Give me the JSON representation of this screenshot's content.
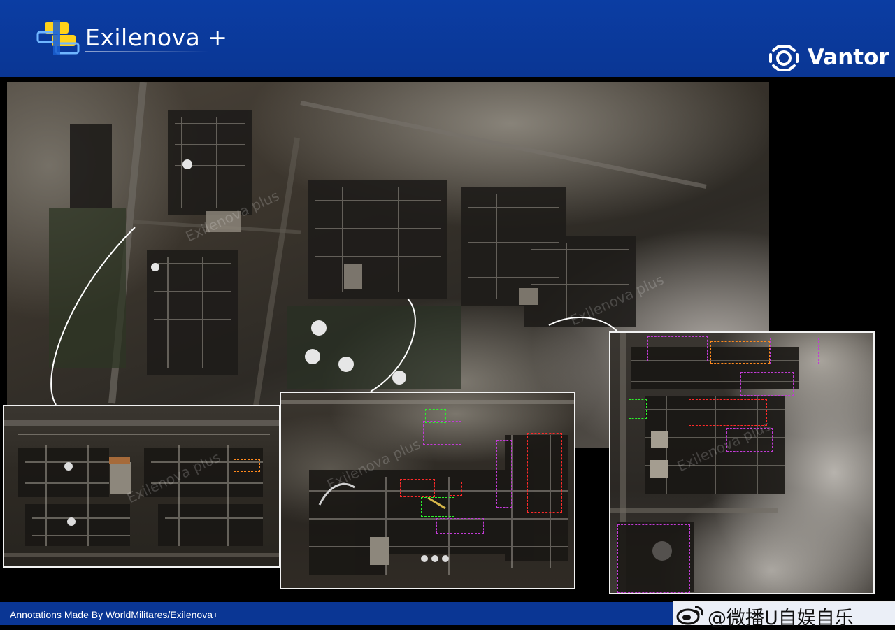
{
  "header": {
    "brand_left": "Exilenova +",
    "brand_right": "Vantor",
    "accent_color": "#0a3694"
  },
  "footer": {
    "credit": "Annotations Made By WorldMilitares/Exilenova+",
    "weibo_handle": "@微播U自娱自乐"
  },
  "watermark_text": "Exilenova plus",
  "annotation_colors": {
    "red": "#ff2a2a",
    "green": "#2cf02c",
    "magenta": "#c23bd6",
    "orange": "#ff8a1e"
  },
  "icons": {
    "left_logo": "exilenova-logo-icon",
    "right_logo": "vantor-logo-icon",
    "weibo": "weibo-icon"
  }
}
